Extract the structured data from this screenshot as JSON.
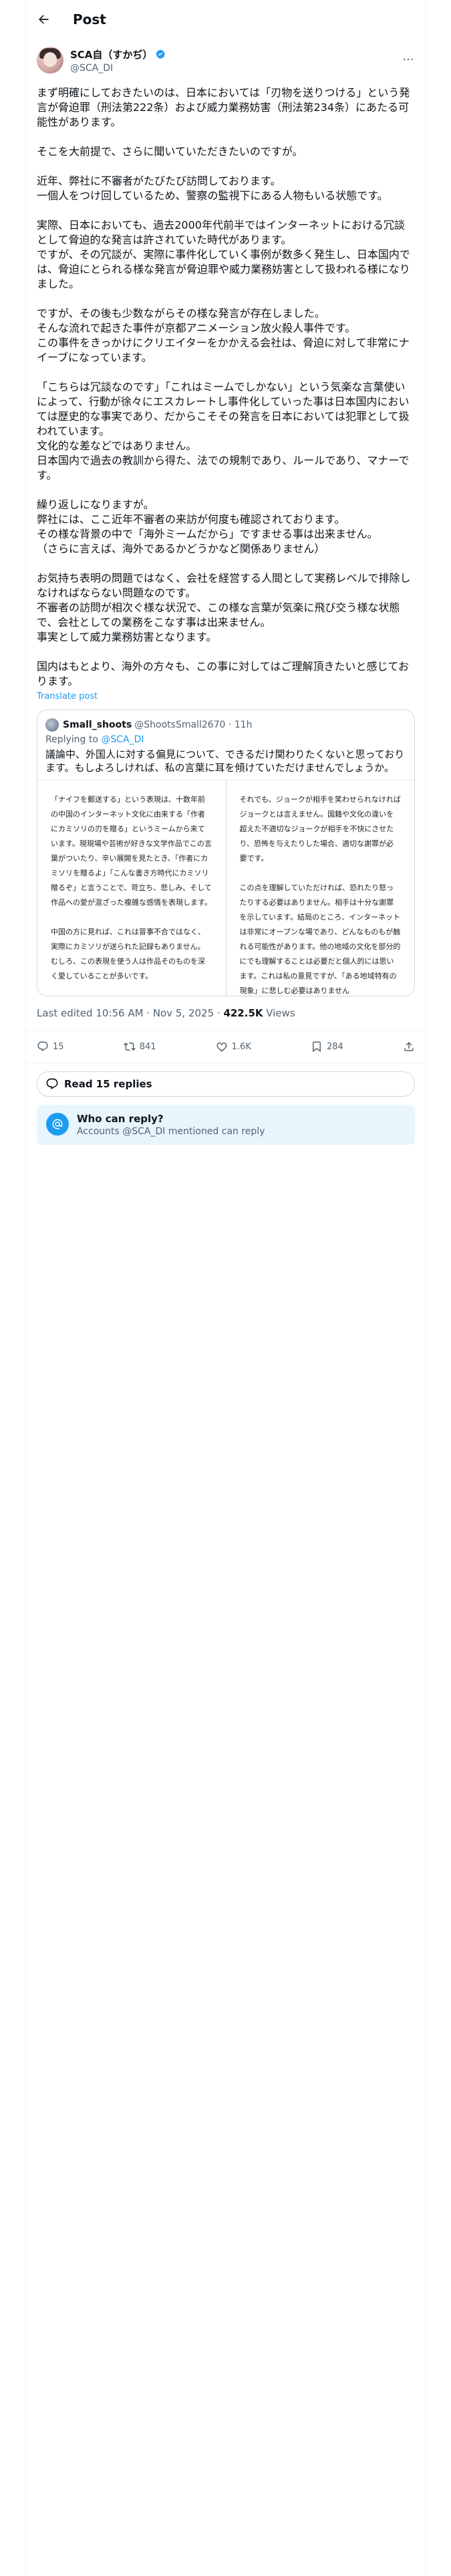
{
  "header": {
    "title": "Post"
  },
  "author": {
    "name": "SCA自（すかぢ）",
    "handle": "@SCA_DI"
  },
  "post": {
    "text": "まず明確にしておきたいのは、日本においては「刃物を送りつける」という発言が脅迫罪（刑法第222条）および威力業務妨害（刑法第234条）にあたる可能性があります。\n\nそこを大前提で、さらに聞いていただきたいのですが。\n\n近年、弊社に不審者がたびたび訪問しております。\n一個人をつけ回しているため、警察の監視下にある人物もいる状態です。\n\n実際、日本においても、過去2000年代前半ではインターネットにおける冗談として脅迫的な発言は許されていた時代があります。\nですが、その冗談が、実際に事件化していく事例が数多く発生し、日本国内では、脅迫にとられる様な発言が脅迫罪や威力業務妨害として扱われる様になりました。\n\nですが、その後も少数ながらその様な発言が存在しました。\nそんな流れで起きた事件が京都アニメーション放火殺人事件です。\nこの事件をきっかけにクリエイターをかかえる会社は、脅迫に対して非常にナイーブになっています。\n\n「こちらは冗談なのです」「これはミームでしかない」という気楽な言葉使いによって、行動が徐々にエスカレートし事件化していった事は日本国内においては歴史的な事実であり、だからこそその発言を日本においては犯罪として扱われています。\n文化的な差などではありません。\n日本国内で過去の教訓から得た、法での規制であり、ルールであり、マナーです。\n\n繰り返しになりますが。\n弊社には、ここ近年不審者の来訪が何度も確認されております。\nその様な背景の中で「海外ミームだから」ですませる事は出来ません。\n（さらに言えば、海外であるかどうかなど関係ありません）\n\nお気持ち表明の問題ではなく、会社を経営する人間として実務レベルで排除しなければならない問題なのです。\n不審者の訪問が相次ぐ様な状況で、この様な言葉が気楽に飛び交う様な状態で、会社としての業務をこなす事は出来ません。\n事実として威力業務妨害となります。\n\n国内はもとより、海外の方々も、この事に対してはご理解頂きたいと感じております。",
    "translate_label": "Translate post",
    "meta_time": "Last edited 10:56 AM · Nov 5, 2025 · ",
    "meta_views_count": "422.5K",
    "meta_views_label": " Views"
  },
  "quote": {
    "name": "Small_shoots",
    "handle_time": "@ShootsSmall2670 · 11h",
    "replying_prefix": "Replying to ",
    "replying_mention": "@SCA_DI",
    "text": "議論中、外国人に対する偏見について、できるだけ関わりたくないと思っております。もしよろしければ、私の言葉に耳を傾けていただけませんでしょうか。",
    "page_left": "「ナイフを郵送する」という表現は、十数年前の中国のインターネット文化に由来する「作者にカミソリの刃を贈る」というミームから来ています。現現場や芸術が好きな文学作品でこの言葉がついたり、辛い展開を見たとき、「作者にカミソリを贈るよ」「こんな書き方時代にカミソリ贈るぞ」と言うことで、苛立ち、悲しみ、そして作品への愛が混ざった複雑な感情を表現します。\n\n中国の方に見れば、これは冒事不合ではなく、実際にカミソリが送られた記録もありません。むしろ、この表現を使う人は作品そのものを深く愛していることが多いです。",
    "page_right": "それでも、ジョークが相手を笑わせられなければジョークとは言えません。国籍や文化の違いを超えた不適切なジョークが相手を不快にさせたり、恐怖を与えたりした場合、適切な謝罪が必要です。\n\nこの点を理解していただければ、恐れたり怒ったりする必要はありません。相手は十分な謝罪を示しています。結局のところ、インターネットは非常にオープンな場であり、どんなものもが触れる可能性があります。他の地域の文化を部分的にでも理解することは必要だと個人的には思います。これは私の意見ですが、「ある地域特有の現象」に悲しむ必要はありません"
  },
  "actions": {
    "replies": "15",
    "reposts": "841",
    "likes": "1.6K",
    "bookmarks": "284"
  },
  "read_replies": "Read 15 replies",
  "who_can_reply": {
    "title": "Who can reply?",
    "desc": "Accounts @SCA_DI mentioned can reply"
  },
  "colors": {
    "accent": "#1d9bf0",
    "muted": "#536471",
    "border": "#eff3f4"
  }
}
